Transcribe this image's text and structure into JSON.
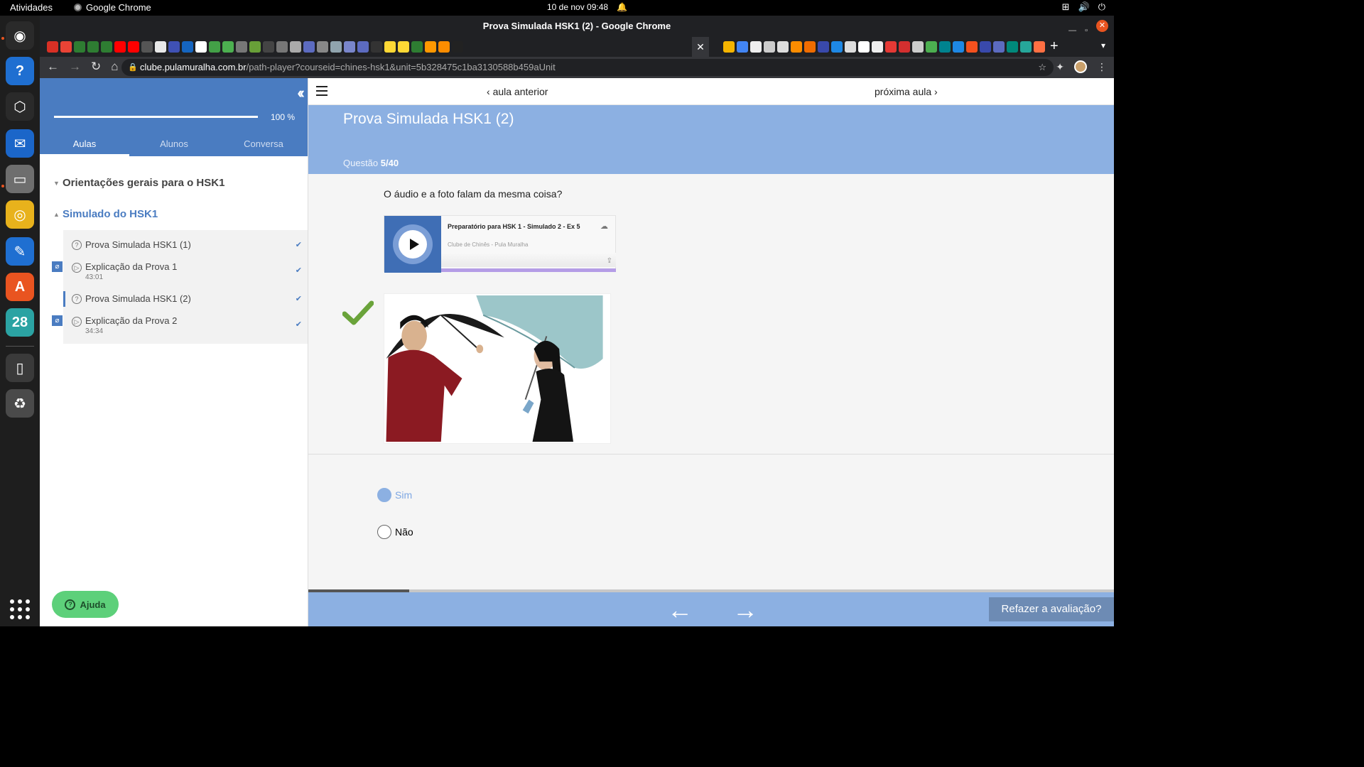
{
  "os": {
    "activities": "Atividades",
    "app_name": "Google Chrome",
    "clock": "10 de nov  09:48",
    "dock": [
      {
        "name": "chrome-icon",
        "color": "#2a2a2a"
      },
      {
        "name": "help-icon",
        "color": "#1f6fd1"
      },
      {
        "name": "cube-app-icon",
        "color": "#2a2a2a"
      },
      {
        "name": "thunderbird-icon",
        "color": "#1b66c9"
      },
      {
        "name": "files-icon",
        "color": "#6e6e6e"
      },
      {
        "name": "rhythmbox-icon",
        "color": "#e8b21c"
      },
      {
        "name": "writer-icon",
        "color": "#1f6fd1"
      },
      {
        "name": "app-store-icon",
        "color": "#e95420"
      },
      {
        "name": "calendar-icon",
        "color": "#2ba3a3"
      },
      {
        "name": "device-icon",
        "color": "#3a3a3a"
      },
      {
        "name": "trash-icon",
        "color": "#4a4a4a"
      }
    ],
    "calendar_day": "28"
  },
  "browser": {
    "window_title": "Prova Simulada HSK1 (2) - Google Chrome",
    "url_host": "clube.pulamuralha.com.br",
    "url_path": "/path-player?courseid=chines-hsk1&unit=5b328475c1ba3130588b459aUnit"
  },
  "sidebar": {
    "progress_label": "100 %",
    "progress": 1.0,
    "tabs": [
      "Aulas",
      "Alunos",
      "Conversa"
    ],
    "active_tab": 0,
    "modules": [
      {
        "title": "Orientações gerais para o HSK1",
        "open": false
      },
      {
        "title": "Simulado do HSK1",
        "open": true
      }
    ],
    "lessons": [
      {
        "title": "Prova Simulada HSK1 (1)",
        "type": "quiz",
        "duration": "",
        "done": true,
        "current": false,
        "attachment": false
      },
      {
        "title": "Explicação da Prova 1",
        "type": "video",
        "duration": "43:01",
        "done": true,
        "current": false,
        "attachment": true
      },
      {
        "title": "Prova Simulada HSK1 (2)",
        "type": "quiz",
        "duration": "",
        "done": true,
        "current": true,
        "attachment": false
      },
      {
        "title": "Explicação da Prova 2",
        "type": "video",
        "duration": "34:34",
        "done": true,
        "current": false,
        "attachment": true
      }
    ],
    "help_label": "Ajuda"
  },
  "main": {
    "prev_label": "aula anterior",
    "next_label": "próxima aula",
    "title": "Prova Simulada HSK1 (2)",
    "question_prefix": "Questão",
    "question_number": "5/40",
    "question_text": "O áudio e a foto falam da mesma coisa?",
    "player": {
      "title": "Preparatório para HSK 1 - Simulado 2 - Ex 5",
      "author": "Clube de Chinês - Pula Muralha"
    },
    "options": [
      {
        "label": "Sim",
        "selected": true
      },
      {
        "label": "Não",
        "selected": false
      }
    ],
    "quiz_progress": 0.125,
    "retake_label": "Refazer a avaliação?",
    "accent": "#8cb0e2",
    "sidebar_accent": "#4a7cc1",
    "correct_color": "#6aa33a"
  }
}
